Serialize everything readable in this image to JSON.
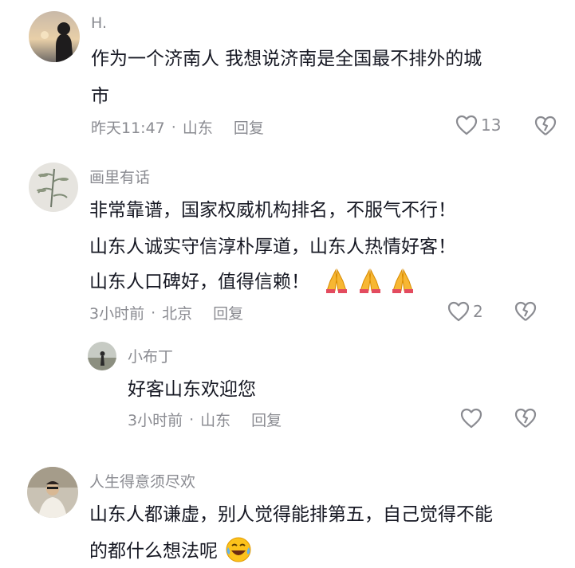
{
  "comments": [
    {
      "username": "H.",
      "lines": [
        "作为一个济南人 我想说济南是全国最不排外的城",
        "市"
      ],
      "time": "昨天11:47",
      "location": "山东",
      "reply_label": "回复",
      "likes": "13"
    },
    {
      "username": "画里有话",
      "lines": [
        "非常靠谱，国家权威机构排名，不服气不行！",
        "山东人诚实守信淳朴厚道，山东人热情好客！",
        "山东人口碑好，值得信赖！"
      ],
      "time": "3小时前",
      "location": "北京",
      "reply_label": "回复",
      "likes": "2",
      "emoji_icons": [
        "folded-hands-emoji",
        "folded-hands-emoji",
        "folded-hands-emoji"
      ]
    },
    {
      "username": "小布丁",
      "lines": [
        "好客山东欢迎您"
      ],
      "time": "3小时前",
      "location": "山东",
      "reply_label": "回复",
      "likes": ""
    },
    {
      "username": "人生得意须尽欢",
      "lines": [
        "山东人都谦虚，别人觉得能排第五，自己觉得不能",
        "的都什么想法呢"
      ],
      "emoji_icons": [
        "laughing-tears-emoji"
      ]
    }
  ],
  "meta_separator": "·",
  "colors": {
    "text": "#161823",
    "secondary": "#8a8b91"
  }
}
